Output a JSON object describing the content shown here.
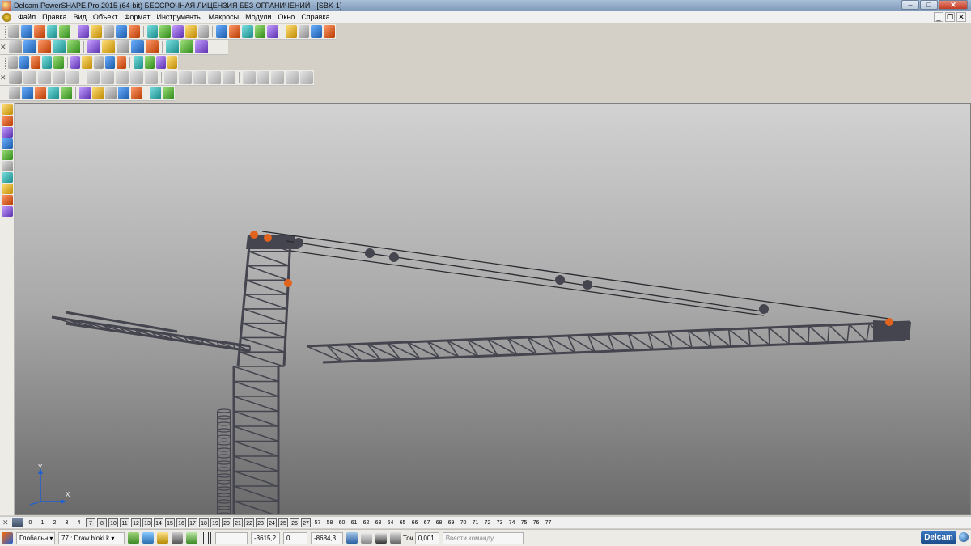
{
  "window": {
    "title": "Delcam PowerSHAPE Pro 2015 (64-bit) БЕССРОЧНАЯ ЛИЦЕНЗИЯ БЕЗ ОГРАНИЧЕНИЙ - [SBK-1]",
    "buttons": {
      "minimize": "–",
      "maximize": "□",
      "close": "✕"
    },
    "mdi_buttons": {
      "minimize": "_",
      "restore": "❐",
      "close": "✕"
    }
  },
  "menu": [
    "Файл",
    "Правка",
    "Вид",
    "Объект",
    "Формат",
    "Инструменты",
    "Макросы",
    "Модули",
    "Окно",
    "Справка"
  ],
  "toolbars": {
    "row1": [
      "new",
      "open",
      "save",
      "save-as",
      "print",
      "cut",
      "copy",
      "paste",
      "select-all",
      "delete",
      "undo",
      "redo",
      "sketch",
      "measure",
      "angle",
      "circle",
      "spline",
      "curve-tools",
      "text",
      "fill",
      "model",
      "render",
      "wireframe",
      "options"
    ],
    "row2": [
      "view-iso1",
      "view-iso2",
      "view-iso3",
      "view-iso4",
      "view-iso5",
      "zoom-in",
      "zoom-out",
      "zoom-fit",
      "rotate",
      "shade",
      "light",
      "drill",
      "hand"
    ],
    "row3": [
      "layers",
      "material",
      "sphere",
      "cone",
      "block",
      "torus",
      "ball",
      "triangle",
      "wedge",
      "prism",
      "box",
      "gear",
      "cylinder",
      "morph"
    ],
    "row4": [
      "sphere-gray",
      "shade1",
      "shade2",
      "shade3",
      "shade4",
      "shade5",
      "shade6",
      "shade7",
      "shade8",
      "shade9",
      "shade10",
      "shade11",
      "shade12",
      "shade13",
      "shade14",
      "shade15",
      "shade16",
      "shade17",
      "shade18",
      "shade19"
    ],
    "row5": [
      "sphere",
      "measure",
      "bool",
      "model-view",
      "cube",
      "cube2",
      "fillet",
      "surface",
      "solid",
      "tree",
      "analysis",
      "triangle"
    ]
  },
  "left_toolbar": [
    "select",
    "dims",
    "solid1",
    "solid2",
    "solid3",
    "solid4",
    "solid5",
    "solid6",
    "solid7",
    "solid8"
  ],
  "viewport": {
    "axis_y_label": "Y",
    "axis_x_label": "X",
    "background": [
      "#d2d2d2",
      "#6a6a6a"
    ],
    "model_color": "#45454f",
    "accent_color": "#e0631e"
  },
  "levels": [
    "0",
    "1",
    "2",
    "3",
    "4",
    "7",
    "8",
    "10",
    "11",
    "12",
    "13",
    "14",
    "15",
    "16",
    "17",
    "18",
    "19",
    "20",
    "21",
    "22",
    "23",
    "24",
    "25",
    "26",
    "27",
    "57",
    "58",
    "60",
    "61",
    "62",
    "63",
    "64",
    "65",
    "66",
    "67",
    "68",
    "69",
    "70",
    "71",
    "72",
    "73",
    "74",
    "75",
    "76",
    "77"
  ],
  "boxed_levels": [
    "7",
    "8",
    "10",
    "11",
    "12",
    "13",
    "14",
    "15",
    "16",
    "17",
    "18",
    "19",
    "20",
    "21",
    "22",
    "23",
    "24",
    "25",
    "26",
    "27"
  ],
  "status": {
    "workplane": "Глобальн ▾",
    "level_select": "77 : Draw bloki k ▾",
    "coord_x": "-3615,2",
    "coord_y": "0",
    "coord_z": "-8684,3",
    "tolerance_label": "Точ",
    "tolerance_value": "0,001",
    "command_placeholder": "Ввести команду",
    "logo": "Delcam"
  }
}
